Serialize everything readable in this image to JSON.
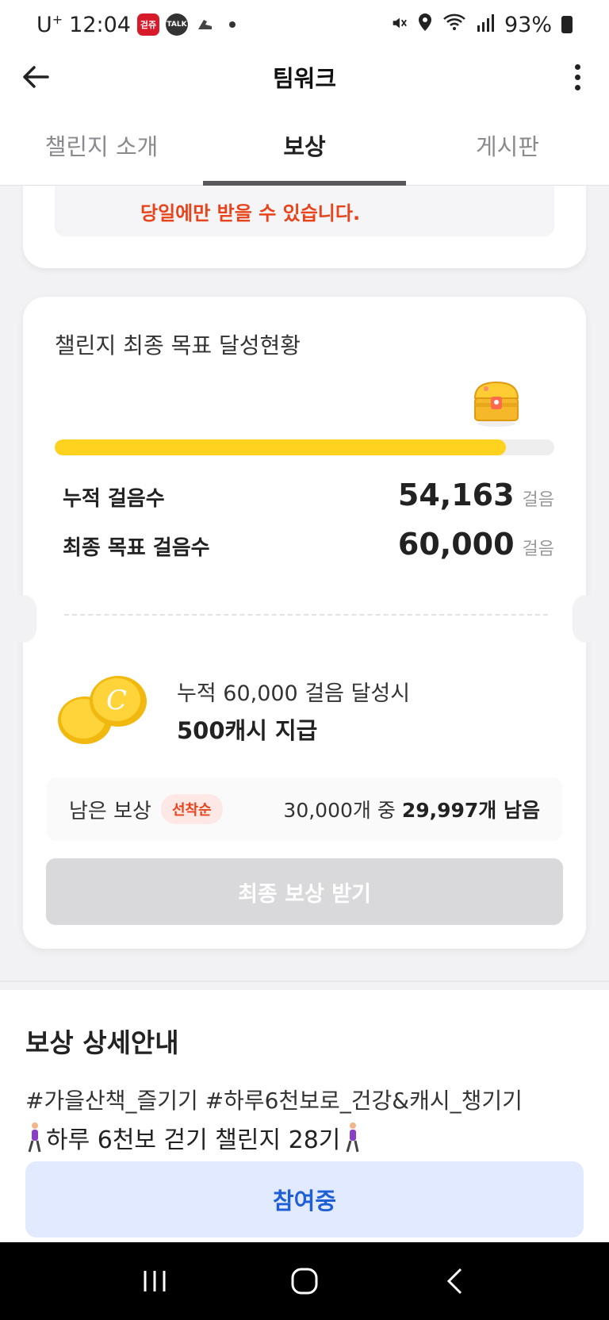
{
  "status_bar": {
    "carrier": "U",
    "carrier_sup": "+",
    "time": "12:04",
    "app_badge_1": "걷쥬",
    "app_badge_2": "TALK",
    "battery": "93%"
  },
  "header": {
    "title": "팀워크"
  },
  "tabs": [
    {
      "label": "챌린지 소개",
      "active": false
    },
    {
      "label": "보상",
      "active": true
    },
    {
      "label": "게시판",
      "active": false
    }
  ],
  "notice": {
    "text": "당일에만 받을 수 있습니다."
  },
  "goal": {
    "title": "챌린지 최종 목표 달성현황",
    "progress_percent": 90.3,
    "stats": [
      {
        "label": "누적 걸음수",
        "value": "54,163",
        "unit": "걸음"
      },
      {
        "label": "최종 목표 걸음수",
        "value": "60,000",
        "unit": "걸음"
      }
    ]
  },
  "reward": {
    "condition": "누적 60,000 걸음 달성시",
    "amount": "500캐시 지급",
    "remaining_label": "남은 보상",
    "first_come_badge": "선착순",
    "remaining_total": "30,000개 중",
    "remaining_count": "29,997개 남음",
    "claim_button": "최종 보상 받기"
  },
  "details": {
    "title": "보상 상세안내",
    "tags": "#가을산책_즐기기 #하루6천보로_건강&캐시_챙기기",
    "description": "하루 6천보 걷기 챌린지 28기",
    "join_button": "참여중"
  },
  "colors": {
    "accent_yellow": "#ffd21f",
    "notice_red": "#e8431b",
    "join_blue": "#1f5fd6",
    "join_bg": "#e1eaff"
  }
}
